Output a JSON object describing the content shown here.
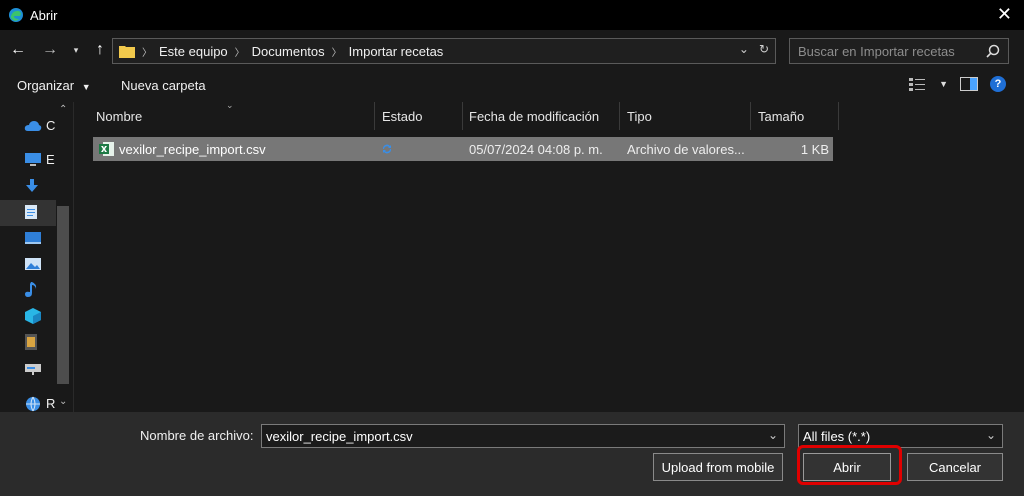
{
  "window": {
    "title": "Abrir",
    "icon": "edge-browser-icon"
  },
  "nav": {
    "breadcrumb": [
      "Este equipo",
      "Documentos",
      "Importar recetas"
    ],
    "search_placeholder": "Buscar en Importar recetas"
  },
  "toolbar": {
    "organize_label": "Organizar",
    "new_folder_label": "Nueva carpeta"
  },
  "sidebar": {
    "items": [
      {
        "label": "C",
        "icon": "onedrive-cloud-icon"
      },
      {
        "label": "E",
        "icon": "this-pc-icon"
      },
      {
        "label": "",
        "icon": "downloads-icon"
      },
      {
        "label": "",
        "icon": "documents-icon"
      },
      {
        "label": "",
        "icon": "desktop-icon"
      },
      {
        "label": "",
        "icon": "pictures-icon"
      },
      {
        "label": "",
        "icon": "music-icon"
      },
      {
        "label": "",
        "icon": "3d-objects-icon"
      },
      {
        "label": "",
        "icon": "videos-icon"
      },
      {
        "label": "",
        "icon": "network-drive-icon"
      },
      {
        "label": "R",
        "icon": "network-icon"
      }
    ]
  },
  "columns": [
    "Nombre",
    "Estado",
    "Fecha de modificación",
    "Tipo",
    "Tamaño"
  ],
  "files": [
    {
      "name": "vexilor_recipe_import.csv",
      "status_icon": "sync-icon",
      "modified": "05/07/2024 04:08 p. m.",
      "type": "Archivo de valores...",
      "size": "1 KB",
      "icon": "excel-csv-icon"
    }
  ],
  "footer": {
    "filename_label": "Nombre de archivo:",
    "filename_value": "vexilor_recipe_import.csv",
    "filetype_value": "All files (*.*)",
    "upload_label": "Upload from mobile",
    "open_label": "Abrir",
    "cancel_label": "Cancelar"
  },
  "colors": {
    "highlight_ring": "#e00000",
    "selected_row": "#777777",
    "accent": "#1f6fd6"
  }
}
